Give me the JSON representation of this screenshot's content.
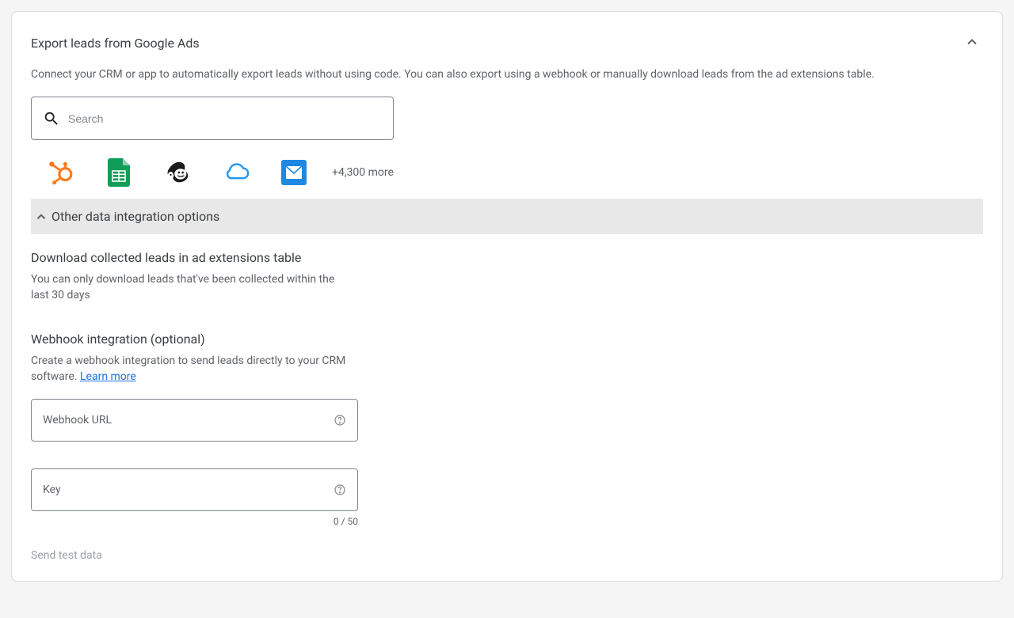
{
  "card": {
    "title": "Export leads from Google Ads",
    "description": "Connect your CRM or app to automatically export leads without using code. You can also export using a webhook or manually download leads from the ad extensions table."
  },
  "search": {
    "placeholder": "Search"
  },
  "integrations": {
    "items": [
      {
        "name": "hubspot"
      },
      {
        "name": "google-sheets"
      },
      {
        "name": "mailchimp"
      },
      {
        "name": "cloud"
      },
      {
        "name": "email"
      }
    ],
    "more_label": "+4,300 more"
  },
  "other_options": {
    "label": "Other data integration options"
  },
  "download_section": {
    "heading": "Download collected leads in ad extensions table",
    "description": "You can only download leads that've been collected within the last 30 days"
  },
  "webhook_section": {
    "heading": "Webhook integration (optional)",
    "description_prefix": "Create a webhook integration to send leads directly to your CRM software. ",
    "learn_more_label": "Learn more",
    "url_field_label": "Webhook URL",
    "key_field_label": "Key",
    "key_char_count": "0 / 50",
    "send_test_label": "Send test data"
  }
}
